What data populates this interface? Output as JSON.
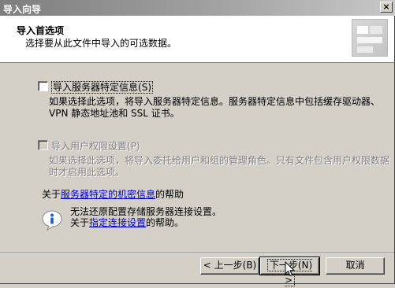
{
  "window": {
    "title": "导入向导",
    "close_label": "×"
  },
  "header": {
    "title": "导入首选项",
    "subtitle": "选择要从此文件中导入的可选数据。"
  },
  "options": [
    {
      "label": "导入服务器特定信息",
      "hotkey": "(S)",
      "description_lines": [
        "如果选择此选项，将导入服务器特定信息。服务器特定信息中包括缓存驱动器、",
        "VPN 静态地址池和 SSL 证书。"
      ],
      "checked": false,
      "enabled": true
    },
    {
      "label": "导入用户权限设置",
      "hotkey": "(P)",
      "description_lines": [
        "如果选择此选项，将导入委托给用户和组的管理角色。只有文件包含用户权限数据",
        "时才启用此选项。"
      ],
      "checked": false,
      "enabled": false
    }
  ],
  "help": {
    "prefix": "关于",
    "link": "服务器特定的机密信息",
    "suffix": "的帮助"
  },
  "info": {
    "line1": "无法还原配置存储服务器连接设置。",
    "line2_prefix": "关于",
    "line2_link": "指定连接设置",
    "line2_suffix": "的帮助。"
  },
  "buttons": {
    "back": "< 上一步(B)",
    "next_text": "下一步",
    "next_hotkey": "(N)",
    "next_arrow": " >",
    "cancel": "取消"
  },
  "colors": {
    "dialog_bg": "#d4d0c8",
    "link": "#0000cc",
    "disabled_text": "#808080",
    "info_icon_blue": "#1f5fbf"
  }
}
